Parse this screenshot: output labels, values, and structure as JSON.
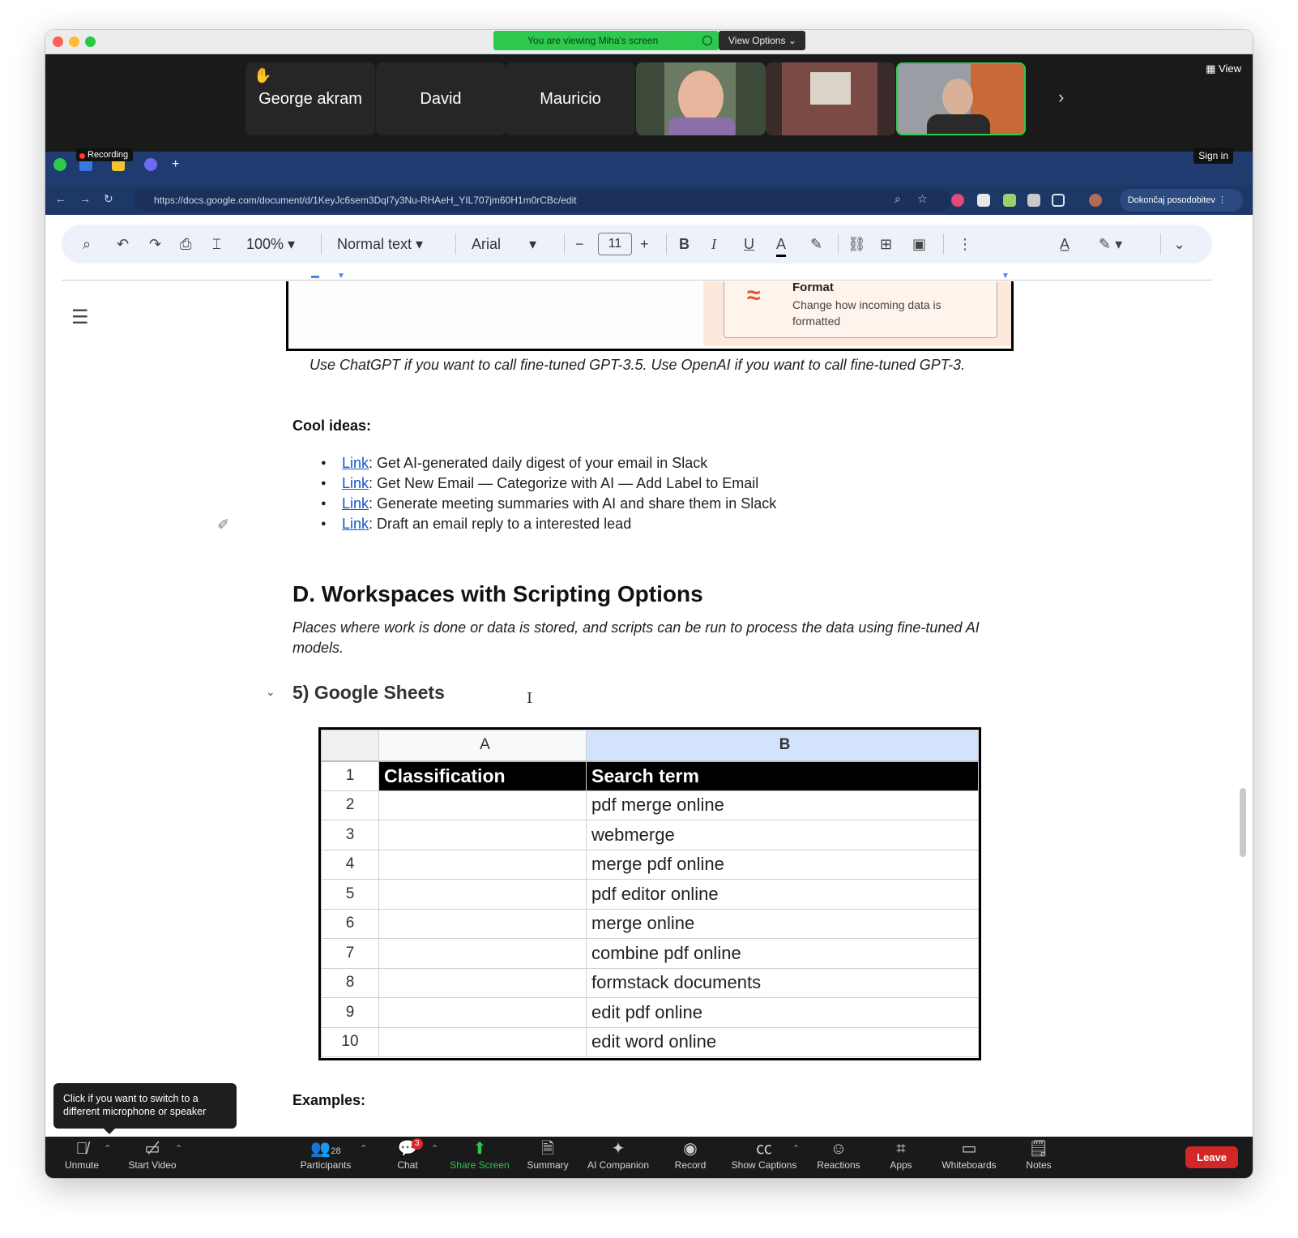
{
  "zoom": {
    "viewing_banner": "You are viewing Miha's screen",
    "view_options": "View Options",
    "view_label": "View",
    "participants_tiles": [
      {
        "name": "George akram",
        "hand_raised": true
      },
      {
        "name": "David"
      },
      {
        "name": "Mauricio"
      }
    ],
    "recording": "Recording",
    "sign_in": "Sign in",
    "tooltip": "Click if you want to switch to a different microphone or speaker",
    "controls": {
      "unmute": "Unmute",
      "start_video": "Start Video",
      "participants": "Participants",
      "participants_count": "28",
      "chat": "Chat",
      "chat_badge": "3",
      "share_screen": "Share Screen",
      "summary": "Summary",
      "ai_companion": "AI Companion",
      "record": "Record",
      "show_captions": "Show Captions",
      "reactions": "Reactions",
      "apps": "Apps",
      "whiteboards": "Whiteboards",
      "notes": "Notes",
      "leave": "Leave"
    },
    "colors": {
      "share_green": "#2dc84d",
      "leave_red": "#d12727"
    }
  },
  "browser": {
    "url": "https://docs.google.com/document/d/1KeyJc6sem3DqI7y3Nu-RHAeH_YIL707jm60H1m0rCBc/edit",
    "finish_update": "Dokončaj posodobitev"
  },
  "docs_toolbar": {
    "zoom": "100%",
    "style": "Normal text",
    "font": "Arial",
    "font_size": "11",
    "bold": "B",
    "italic": "I",
    "underline": "U",
    "text_color": "A"
  },
  "doc": {
    "format_card": {
      "title": "Format",
      "desc": "Change how incoming data is formatted"
    },
    "caption": "Use ChatGPT if you want to call fine-tuned GPT-3.5. Use OpenAI if you want to call fine-tuned GPT-3.",
    "cool_ideas": "Cool ideas:",
    "ideas": [
      {
        "link": "Link",
        "text": ": Get AI-generated daily digest of your email in Slack"
      },
      {
        "link": "Link",
        "text": ": Get New Email — Categorize with AI — Add Label to Email"
      },
      {
        "link": "Link",
        "text": ": Generate meeting summaries with AI and share them in Slack"
      },
      {
        "link": "Link",
        "text": ": Draft an email reply to a interested lead"
      }
    ],
    "section_heading": "D. Workspaces with Scripting Options",
    "section_sub": "Places where work is done or data is stored, and scripts can be run to process the data using fine-tuned AI models.",
    "subheading": "5) Google Sheets",
    "sheet": {
      "columns": [
        "A",
        "B"
      ],
      "header": [
        "Classification",
        "Search term"
      ],
      "rows": [
        {
          "n": "1"
        },
        {
          "n": "2",
          "b": "pdf merge online"
        },
        {
          "n": "3",
          "b": "webmerge"
        },
        {
          "n": "4",
          "b": "merge pdf online"
        },
        {
          "n": "5",
          "b": "pdf editor online"
        },
        {
          "n": "6",
          "b": "merge online"
        },
        {
          "n": "7",
          "b": "combine pdf online"
        },
        {
          "n": "8",
          "b": "formstack documents"
        },
        {
          "n": "9",
          "b": "edit pdf online"
        },
        {
          "n": "10",
          "b": "edit word online"
        }
      ]
    },
    "examples": "Examples:"
  }
}
